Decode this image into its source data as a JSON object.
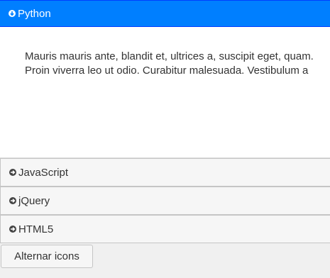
{
  "accordion": {
    "sections": [
      {
        "label": "Python",
        "icon": "arrow-down-circle-icon",
        "state": "expanded"
      },
      {
        "label": "JavaScript",
        "icon": "arrow-right-circle-icon",
        "state": "collapsed"
      },
      {
        "label": "jQuery",
        "icon": "arrow-right-circle-icon",
        "state": "collapsed"
      },
      {
        "label": "HTML5",
        "icon": "arrow-right-circle-icon",
        "state": "collapsed"
      }
    ],
    "panel_text": [
      "Mauris mauris ante, blandit et, ultrices a, suscipit eget, quam.",
      "Proin viverra leo ut odio. Curabitur malesuada. Vestibulum a"
    ]
  },
  "toggle_button": {
    "label": "Alternar icons"
  },
  "colors": {
    "active_header_bg": "#007fff",
    "active_header_text": "#ffffff",
    "collapsed_header_bg": "#f6f6f6",
    "text": "#333333"
  }
}
